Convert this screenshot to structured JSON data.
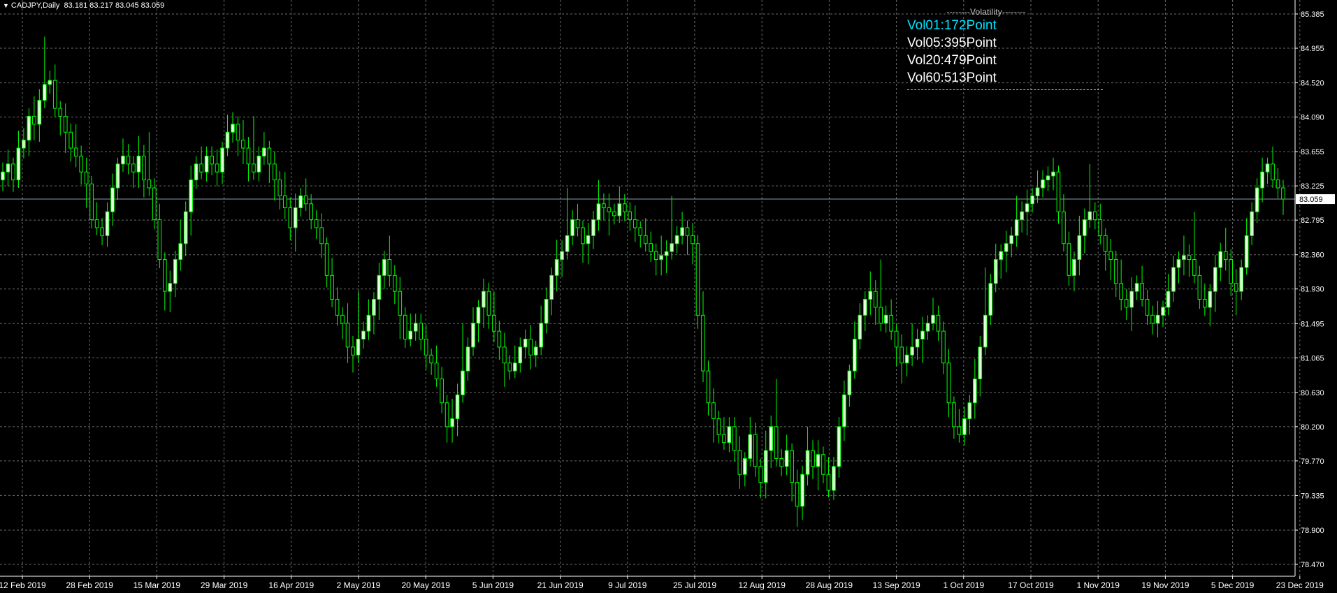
{
  "header": {
    "symbol": "CADJPY,Daily",
    "ohlc": "83.181 83.217 83.045 83.059"
  },
  "volatility_panel": {
    "title": "--------Volatility--------",
    "lines": [
      {
        "label": "Vol01:172Point",
        "color": "#00e5ff"
      },
      {
        "label": "Vol05:395Point",
        "color": "#ffffff"
      },
      {
        "label": "Vol20:479Point",
        "color": "#ffffff"
      },
      {
        "label": "Vol60:513Point",
        "color": "#ffffff"
      }
    ]
  },
  "colors": {
    "background": "#000000",
    "grid": "#6b6b6b",
    "candle_bull": "#e6ffdc",
    "candle_wick": "#00ff00",
    "price_line": "#8a9bb3",
    "axis_text": "#ffffff"
  },
  "chart_data": {
    "type": "candlestick",
    "title": "CADJPY,Daily",
    "current_price": 83.059,
    "current_price_label": "83.059",
    "ylim": [
      78.25,
      85.5
    ],
    "y_ticks": [
      "85.385",
      "84.955",
      "84.520",
      "84.090",
      "83.655",
      "83.225",
      "82.795",
      "82.360",
      "81.930",
      "81.495",
      "81.065",
      "80.630",
      "80.200",
      "79.770",
      "79.335",
      "78.900",
      "78.470"
    ],
    "x_ticks": [
      "12 Feb 2019",
      "28 Feb 2019",
      "15 Mar 2019",
      "29 Mar 2019",
      "16 Apr 2019",
      "2 May 2019",
      "20 May 2019",
      "5 Jun 2019",
      "21 Jun 2019",
      "9 Jul 2019",
      "25 Jul 2019",
      "12 Aug 2019",
      "28 Aug 2019",
      "13 Sep 2019",
      "1 Oct 2019",
      "17 Oct 2019",
      "1 Nov 2019",
      "19 Nov 2019",
      "5 Dec 2019",
      "23 Dec 2019"
    ],
    "grid": true,
    "closes": [
      83.4,
      83.5,
      83.3,
      83.7,
      83.8,
      84.1,
      84.0,
      84.3,
      84.5,
      84.55,
      84.2,
      84.1,
      83.9,
      83.7,
      83.6,
      83.4,
      83.25,
      82.8,
      82.7,
      82.6,
      82.9,
      83.2,
      83.5,
      83.6,
      83.5,
      83.4,
      83.6,
      83.3,
      83.2,
      82.8,
      82.3,
      81.9,
      82.0,
      82.3,
      82.5,
      82.9,
      83.3,
      83.5,
      83.4,
      83.6,
      83.5,
      83.4,
      83.7,
      83.9,
      84.0,
      83.8,
      83.7,
      83.5,
      83.4,
      83.6,
      83.7,
      83.5,
      83.3,
      83.1,
      82.95,
      82.7,
      82.95,
      83.1,
      83.0,
      82.8,
      82.7,
      82.5,
      82.1,
      81.8,
      81.6,
      81.5,
      81.2,
      81.1,
      81.3,
      81.4,
      81.6,
      81.8,
      82.1,
      82.3,
      82.1,
      81.9,
      81.6,
      81.3,
      81.4,
      81.5,
      81.3,
      81.1,
      81.0,
      80.8,
      80.5,
      80.2,
      80.3,
      80.6,
      80.9,
      81.2,
      81.5,
      81.7,
      81.9,
      81.6,
      81.4,
      81.2,
      81.0,
      80.9,
      81.0,
      81.2,
      81.3,
      81.1,
      81.2,
      81.5,
      81.8,
      82.1,
      82.3,
      82.4,
      82.6,
      82.8,
      82.7,
      82.5,
      82.6,
      82.8,
      83.0,
      82.95,
      82.9,
      82.85,
      83.0,
      82.9,
      82.8,
      82.7,
      82.6,
      82.5,
      82.4,
      82.3,
      82.35,
      82.4,
      82.5,
      82.6,
      82.7,
      82.6,
      82.5,
      81.6,
      80.9,
      80.5,
      80.3,
      80.1,
      80.0,
      80.2,
      79.9,
      79.6,
      79.8,
      80.1,
      79.7,
      79.5,
      79.9,
      80.2,
      79.8,
      79.7,
      79.9,
      79.5,
      79.2,
      79.6,
      79.9,
      79.7,
      79.85,
      79.6,
      79.4,
      79.7,
      80.2,
      80.6,
      80.9,
      81.3,
      81.6,
      81.8,
      81.9,
      81.7,
      81.5,
      81.6,
      81.4,
      81.2,
      81.0,
      81.1,
      81.2,
      81.3,
      81.4,
      81.5,
      81.6,
      81.4,
      81.0,
      80.5,
      80.2,
      80.1,
      80.3,
      80.5,
      80.8,
      81.2,
      81.6,
      82.0,
      82.3,
      82.4,
      82.5,
      82.6,
      82.8,
      82.9,
      83.0,
      83.1,
      83.2,
      83.3,
      83.35,
      83.4,
      82.9,
      82.5,
      82.1,
      82.3,
      82.6,
      82.8,
      82.9,
      82.8,
      82.6,
      82.4,
      82.3,
      82.0,
      81.8,
      81.7,
      81.9,
      82.0,
      81.8,
      81.6,
      81.5,
      81.6,
      81.7,
      81.9,
      82.2,
      82.3,
      82.35,
      82.3,
      82.1,
      81.8,
      81.7,
      81.9,
      82.2,
      82.4,
      82.3,
      82.0,
      81.9,
      82.2,
      82.6,
      82.9,
      83.2,
      83.4,
      83.5,
      83.3,
      83.2,
      83.059
    ],
    "high_offsets": [
      0.12,
      0.18,
      0.08,
      0.22,
      0.15,
      0.1,
      0.25,
      0.14,
      0.6,
      0.12,
      0.2,
      0.09,
      0.16,
      0.11,
      0.3,
      0.13,
      0.18,
      0.1,
      0.22,
      0.12
    ],
    "low_offsets": [
      0.14,
      0.1,
      0.2,
      0.12,
      0.26,
      0.16,
      0.09,
      0.18,
      0.13,
      0.22,
      0.11,
      0.17,
      0.3,
      0.12,
      0.15,
      0.2,
      0.1,
      0.24,
      0.14,
      0.11
    ]
  }
}
